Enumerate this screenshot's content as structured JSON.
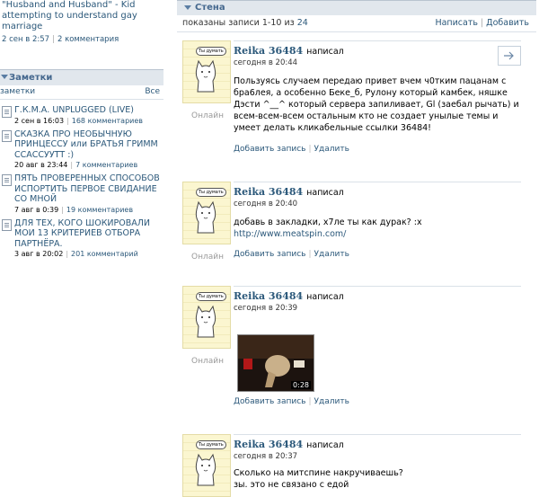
{
  "left": {
    "top_item": {
      "title": "\"Husband and Husband\" - Kid attempting to understand gay marriage",
      "date": "2 сен в 2:57",
      "comments": "2 комментария"
    },
    "notes_header": "Заметки",
    "notes_sub_left": "заметки",
    "notes_sub_right": "Все",
    "notes": [
      {
        "title": "Г.К.М.А. UNPLUGGED (LIVE)",
        "date": "2 сен в 16:03",
        "comments": "168 комментариев"
      },
      {
        "title": "СКАЗКА ПРО НЕОБЫЧНУЮ ПРИНЦЕССУ или БРАТЬЯ ГРИММ ССАССУУТТ :)",
        "date": "20 авг в 23:44",
        "comments": "7 комментариев"
      },
      {
        "title": "ПЯТЬ ПРОВЕРЕННЫХ СПОСОБОВ ИСПОРТИТЬ ПЕРВОЕ СВИДАНИЕ СО МНОЙ",
        "date": "7 авг в 0:39",
        "comments": "19 комментариев"
      },
      {
        "title": "ДЛЯ ТЕХ, КОГО ШОКИРОВАЛИ МОИ 13 КРИТЕРИЕВ ОТБОРА ПАРТНЁРА.",
        "date": "3 авг в 20:02",
        "comments": "201 комментарий"
      }
    ]
  },
  "wall": {
    "header": "Стена",
    "shown_prefix": "показаны записи 1-10 из",
    "total": "24",
    "write": "Написать",
    "add": "Добавить",
    "avatar_bubble": "Ты думать",
    "online": "Онлайн",
    "add_post": "Добавить запись",
    "delete": "Удалить",
    "posts": [
      {
        "author": "Reika 36484",
        "action": "написал",
        "time": "сегодня в 20:44",
        "text": "Пользуясь случаем передаю привет вчем ч0тким пацанам с бра6лея, а особенно Беке_б, Рулону который камбек, няшке Дэсти ^__^ который сервера запиливает, Gl (заебал рычать) и всем-всем-всем остальным кто не создает унылые темы и умеет делать кликабельные ссылки 36484!"
      },
      {
        "author": "Reika 36484",
        "action": "написал",
        "time": "сегодня в 20:40",
        "text": "добавь в закладки, х7ле ты как дурак? :x",
        "link": "http://www.meatspin.com/"
      },
      {
        "author": "Reika 36484",
        "action": "написал",
        "time": "сегодня в 20:39",
        "duration": "0:28"
      },
      {
        "author": "Reika 36484",
        "action": "написал",
        "time": "сегодня в 20:37",
        "text": "Сколько на митспине накручиваешь?",
        "text2": "зы. это не связано с едой"
      }
    ]
  }
}
